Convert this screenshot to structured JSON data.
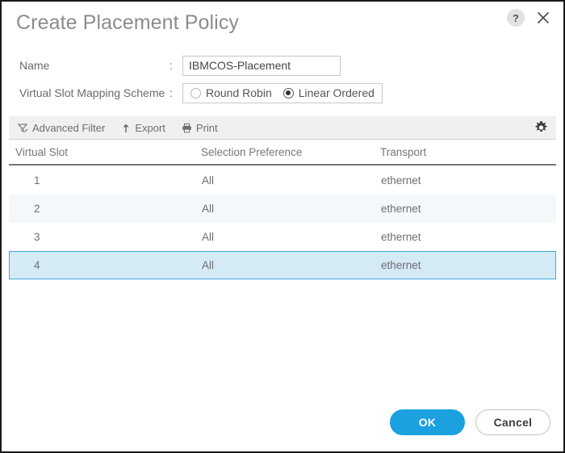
{
  "dialog": {
    "title": "Create Placement Policy",
    "help_icon_glyph": "?",
    "help_icon_name": "help-icon",
    "close_icon_name": "close-icon"
  },
  "form": {
    "name": {
      "label": "Name",
      "colon": ":",
      "value": "IBMCOS-Placement",
      "placeholder": ""
    },
    "mapping_scheme": {
      "label": "Virtual Slot Mapping Scheme",
      "colon": ":",
      "options": [
        {
          "label": "Round Robin",
          "selected": false
        },
        {
          "label": "Linear Ordered",
          "selected": true
        }
      ],
      "selected_value": "Linear Ordered"
    }
  },
  "toolbar": {
    "advanced_filter_label": "Advanced Filter",
    "export_label": "Export",
    "print_label": "Print",
    "settings_icon_name": "gear-icon"
  },
  "table": {
    "columns": [
      "Virtual Slot",
      "Selection Preference",
      "Transport"
    ],
    "rows": [
      {
        "virtual_slot": "1",
        "selection_preference": "All",
        "transport": "ethernet",
        "selected": false
      },
      {
        "virtual_slot": "2",
        "selection_preference": "All",
        "transport": "ethernet",
        "selected": false
      },
      {
        "virtual_slot": "3",
        "selection_preference": "All",
        "transport": "ethernet",
        "selected": false
      },
      {
        "virtual_slot": "4",
        "selection_preference": "All",
        "transport": "ethernet",
        "selected": true
      }
    ]
  },
  "footer": {
    "ok_label": "OK",
    "cancel_label": "Cancel"
  },
  "colors": {
    "accent": "#1ba0e0",
    "selection_border": "#3da7da",
    "selection_fill": "#d4eaf5",
    "row_alt": "#f5f8fa",
    "toolbar_bg": "#f0f0f0",
    "title_text": "#8c8c8c",
    "body_text": "#6e6e6e"
  }
}
